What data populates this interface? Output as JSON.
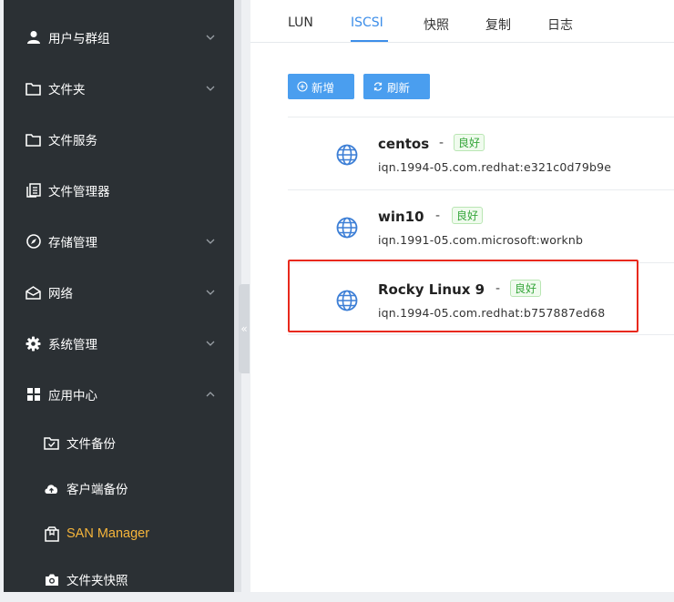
{
  "sidebar": {
    "items": [
      {
        "label": "用户与群组",
        "icon": "user-icon",
        "expandable": true
      },
      {
        "label": "文件夹",
        "icon": "folder-icon",
        "expandable": true
      },
      {
        "label": "文件服务",
        "icon": "folder-icon",
        "expandable": false
      },
      {
        "label": "文件管理器",
        "icon": "file-manager-icon",
        "expandable": false
      },
      {
        "label": "存储管理",
        "icon": "compass-icon",
        "expandable": true
      },
      {
        "label": "网络",
        "icon": "network-icon",
        "expandable": true
      },
      {
        "label": "系统管理",
        "icon": "gear-icon",
        "expandable": true
      },
      {
        "label": "应用中心",
        "icon": "app-grid-icon",
        "expanded": true
      }
    ],
    "subitems": [
      {
        "label": "文件备份",
        "icon": "folder-check-icon"
      },
      {
        "label": "客户端备份",
        "icon": "cloud-upload-icon"
      },
      {
        "label": "SAN Manager",
        "icon": "san-box-icon",
        "active": true
      },
      {
        "label": "文件夹快照",
        "icon": "camera-icon"
      }
    ],
    "collapse_glyph": "«"
  },
  "tabs": [
    "LUN",
    "ISCSI",
    "快照",
    "复制",
    "日志"
  ],
  "active_tab": "ISCSI",
  "toolbar": {
    "new_label": "新增",
    "new_icon": "plus-circle-icon",
    "refresh_label": "刷新",
    "refresh_icon": "refresh-icon"
  },
  "targets": [
    {
      "name": "centos",
      "status": "良好",
      "iqn": "iqn.1994-05.com.redhat:e321c0d79b9e"
    },
    {
      "name": "win10",
      "status": "良好",
      "iqn": "iqn.1991-05.com.microsoft:worknb"
    },
    {
      "name": "Rocky Linux 9",
      "status": "良好",
      "iqn": "iqn.1994-05.com.redhat:b757887ed68"
    }
  ],
  "separator": "-",
  "colors": {
    "sidebar_bg": "#2b3034",
    "active_sub": "#f6b53b",
    "accent": "#3d8ee9",
    "button": "#4a9eef",
    "status_green": "#35a63a",
    "highlight_red": "#e8291c"
  }
}
